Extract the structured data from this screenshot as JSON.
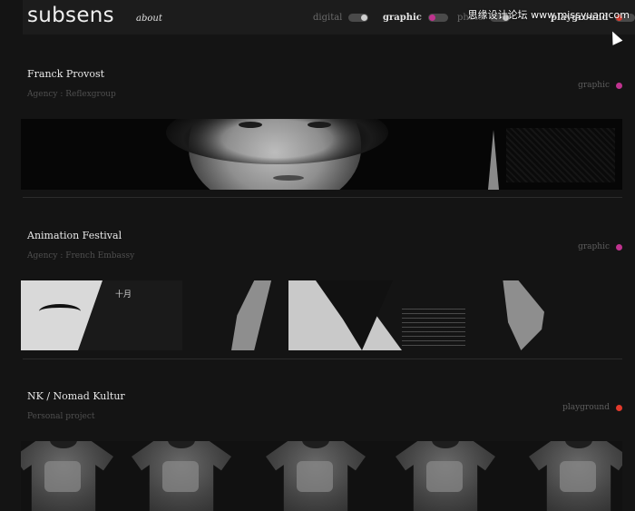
{
  "header": {
    "logo": "subsens",
    "about_label": "about",
    "filters": [
      {
        "label": "digital",
        "active": false
      },
      {
        "label": "graphic",
        "active": true
      },
      {
        "label": "photo",
        "active": false
      },
      {
        "label": "playground",
        "active": true
      }
    ],
    "watermark": "思缘设计论坛 www.missyuan.com"
  },
  "projects": [
    {
      "title": "Franck Provost",
      "client": "Agency : Reflexgroup",
      "category": "graphic",
      "category_color": "#c0338f"
    },
    {
      "title": "Animation Festival",
      "client": "Agency : French Embassy",
      "category": "graphic",
      "category_color": "#c0338f",
      "kanji": "十月"
    },
    {
      "title": "NK / Nomad Kultur",
      "client": "Personal project",
      "category": "playground",
      "category_color": "#e33a2c"
    }
  ],
  "colors": {
    "graphic": "#c0338f",
    "playground": "#e33a2c",
    "background": "#141414"
  }
}
